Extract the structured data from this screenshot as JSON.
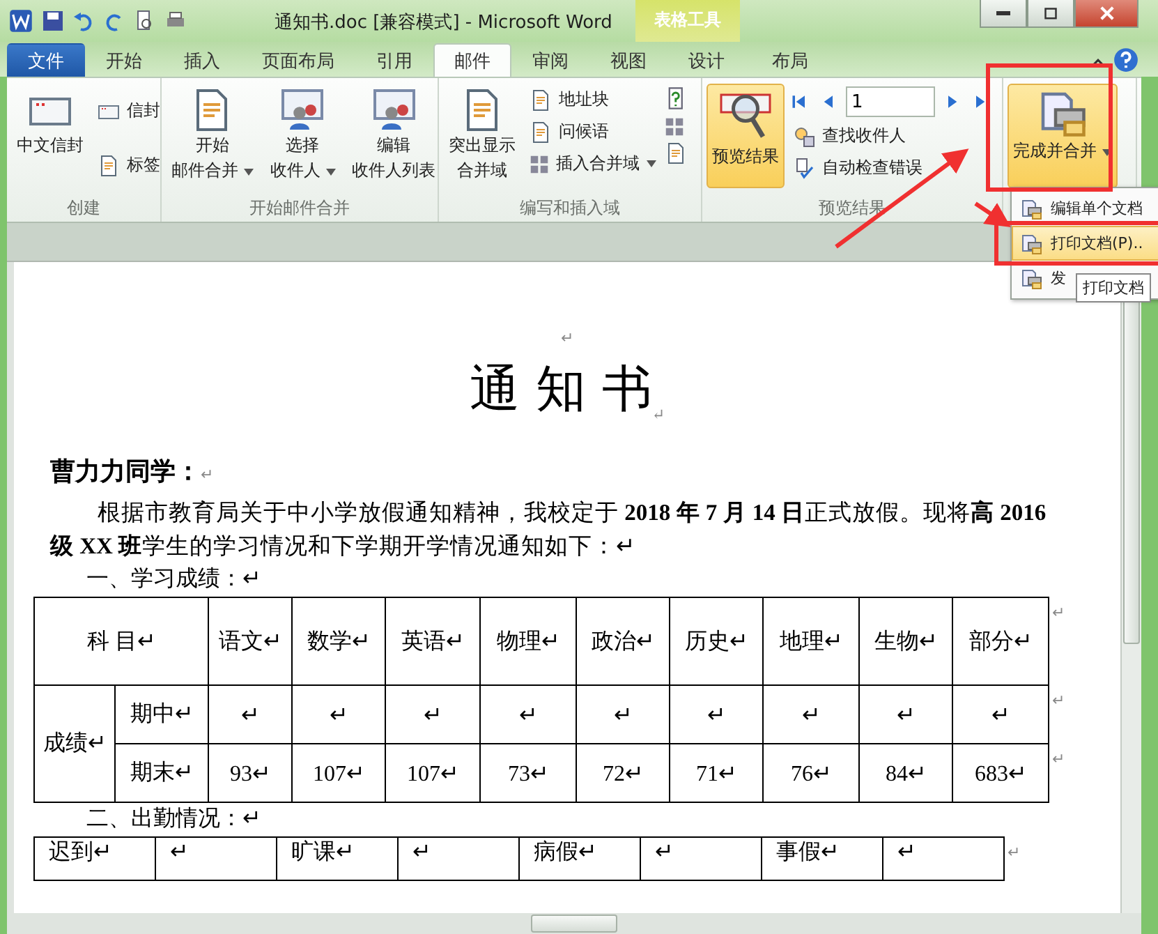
{
  "window": {
    "title": "通知书.doc [兼容模式]  -  Microsoft Word",
    "context_group": "表格工具"
  },
  "tabs": [
    {
      "label": "文件",
      "kind": "file",
      "selected": false
    },
    {
      "label": "开始",
      "kind": "normal",
      "selected": false
    },
    {
      "label": "插入",
      "kind": "normal",
      "selected": false
    },
    {
      "label": "页面布局",
      "kind": "normal",
      "selected": false
    },
    {
      "label": "引用",
      "kind": "normal",
      "selected": false
    },
    {
      "label": "邮件",
      "kind": "normal",
      "selected": true
    },
    {
      "label": "审阅",
      "kind": "normal",
      "selected": false
    },
    {
      "label": "视图",
      "kind": "normal",
      "selected": false
    },
    {
      "label": "设计",
      "kind": "context",
      "selected": false
    },
    {
      "label": "布局",
      "kind": "context",
      "selected": false
    }
  ],
  "ribbon": {
    "groups": [
      {
        "kind": "create",
        "title": "创建",
        "large": [
          {
            "lines": [
              "中文信封"
            ],
            "dropdown": false,
            "highlighted": false
          }
        ],
        "small": [
          {
            "label": "信封",
            "dropdown": false
          },
          {
            "label": "标签",
            "dropdown": false
          }
        ]
      },
      {
        "kind": "start",
        "title": "开始邮件合并",
        "large": [
          {
            "lines": [
              "开始",
              "邮件合并"
            ],
            "dropdown": true,
            "highlighted": false
          },
          {
            "lines": [
              "选择",
              "收件人"
            ],
            "dropdown": true,
            "highlighted": false
          },
          {
            "lines": [
              "编辑",
              "收件人列表"
            ],
            "dropdown": false,
            "highlighted": false
          }
        ]
      },
      {
        "kind": "write",
        "title": "编写和插入域",
        "large": [
          {
            "lines": [
              "突出显示",
              "合并域"
            ],
            "dropdown": false,
            "highlighted": false
          }
        ],
        "small": [
          {
            "label": "地址块",
            "dropdown": false
          },
          {
            "label": "问候语",
            "dropdown": false
          },
          {
            "label": "插入合并域",
            "dropdown": true
          }
        ]
      },
      {
        "kind": "preview",
        "title": "预览结果",
        "large": [
          {
            "lines": [
              "预览结果"
            ],
            "dropdown": false,
            "highlighted": true
          }
        ],
        "record": "1",
        "small": [
          {
            "label": "查找收件人",
            "dropdown": false
          },
          {
            "label": "自动检查错误",
            "dropdown": false
          }
        ]
      },
      {
        "kind": "finish",
        "large": [
          {
            "lines": [
              "完成并合并"
            ],
            "dropdown": true,
            "highlighted": true
          }
        ]
      }
    ]
  },
  "menu": {
    "items": [
      {
        "label": "编辑单个文档",
        "selected": false
      },
      {
        "label": "打印文档(P)..",
        "selected": true
      },
      {
        "label": "发",
        "selected": false
      }
    ],
    "tooltip": "打印文档"
  },
  "document": {
    "top_mark": "↵",
    "heading": "通 知 书",
    "heading_mark": "↵",
    "salutation": "曹力力同学：",
    "salutation_mark": "↵",
    "paragraph": "根据市教育局关于中小学放假通知精神，我校定于 **2018 年 7 月 14 日**正式放假。现将**高 2016 级 XX 班**学生的学习情况和下学期开学情况通知如下：↵",
    "section_1": "一、学习成绩：↵",
    "scores": {
      "corner": "科  目↵",
      "subjects": [
        "语文↵",
        "数学↵",
        "英语↵",
        "物理↵",
        "政治↵",
        "历史↵",
        "地理↵",
        "生物↵",
        "部分↵"
      ],
      "group_label": "成绩↵",
      "rows": [
        {
          "label": "期中↵",
          "cells": [
            "↵",
            "↵",
            "↵",
            "↵",
            "↵",
            "↵",
            "↵",
            "↵",
            "↵"
          ]
        },
        {
          "label": "期末↵",
          "cells": [
            "93↵",
            "107↵",
            "107↵",
            "73↵",
            "72↵",
            "71↵",
            "76↵",
            "84↵",
            "683↵"
          ]
        }
      ],
      "row_marks": [
        "↵",
        "↵",
        "↵"
      ]
    },
    "section_2": "二、出勤情况：↵",
    "attendance": {
      "cells": [
        "迟到↵",
        "↵",
        "旷课↵",
        "↵",
        "病假↵",
        "↵",
        "事假↵",
        "↵"
      ],
      "row_mark": "↵"
    }
  }
}
